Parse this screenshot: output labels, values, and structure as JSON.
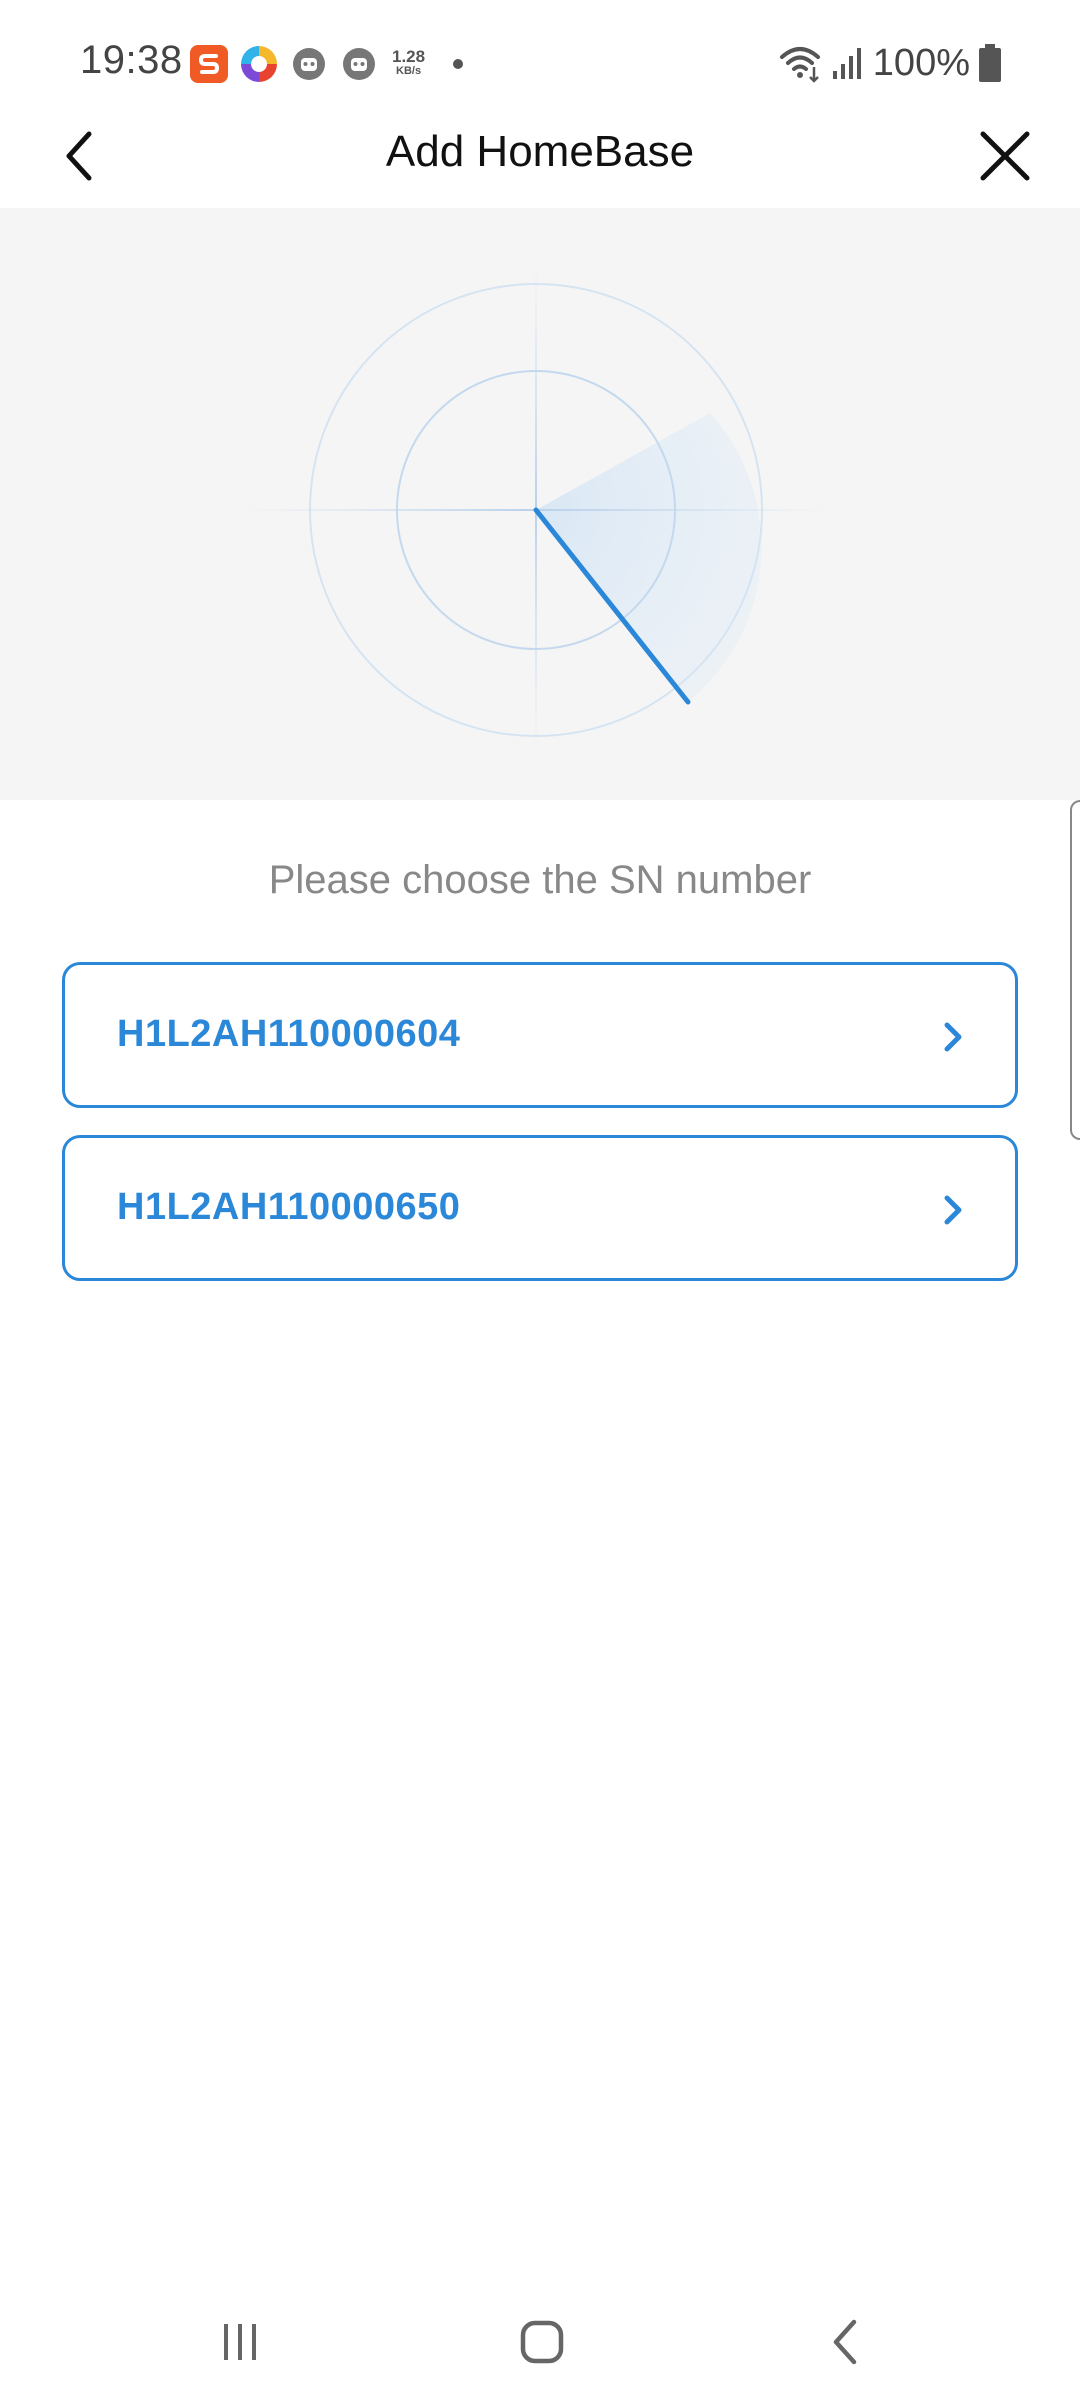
{
  "status_bar": {
    "time": "19:38",
    "speed_value": "1.28",
    "speed_unit": "KB/s",
    "battery": "100%",
    "icons": [
      "sohu-icon",
      "color-circle-icon",
      "bot-icon",
      "bot-icon",
      "wifi-icon",
      "signal-icon",
      "battery-icon"
    ]
  },
  "header": {
    "title": "Add HomeBase",
    "back_icon": "chevron-left-icon",
    "close_icon": "close-icon"
  },
  "content": {
    "prompt": "Please choose the SN number",
    "sn_items": [
      {
        "label": "H1L2AH110000604"
      },
      {
        "label": "H1L2AH110000650"
      }
    ]
  },
  "colors": {
    "accent": "#2b88d8",
    "panel_bg": "#f5f5f5",
    "prompt_text": "#888888"
  },
  "nav_bar": {
    "icons": [
      "recent-apps-icon",
      "home-icon",
      "back-icon"
    ]
  }
}
